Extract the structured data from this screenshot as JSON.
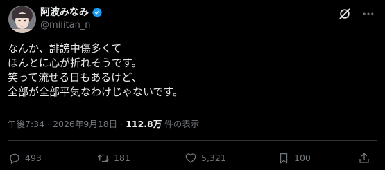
{
  "author": {
    "display_name": "阿波みなみ",
    "handle": "@miiitan_n",
    "verified": true
  },
  "post": {
    "lines": [
      "なんか、誹謗中傷多くて",
      "ほんとに心が折れそうです。",
      "笑って流せる日もあるけど、",
      "全部が全部平気なわけじゃないです。"
    ],
    "time": "午後7:34",
    "separator": "·",
    "date": "2026年9月18日",
    "views_count": "112.8万",
    "views_label": "件の表示"
  },
  "actions": {
    "replies": "493",
    "reposts": "181",
    "likes": "5,321",
    "bookmarks": "100"
  },
  "colors": {
    "background": "#000000",
    "text": "#e7e9ea",
    "secondary": "#71767b",
    "verified": "#1d9bf0",
    "divider": "#2f3336"
  },
  "icons": [
    "verified-badge-icon",
    "grok-icon",
    "more-icon",
    "reply-icon",
    "repost-icon",
    "like-icon",
    "views-icon",
    "bookmark-icon",
    "share-icon"
  ]
}
